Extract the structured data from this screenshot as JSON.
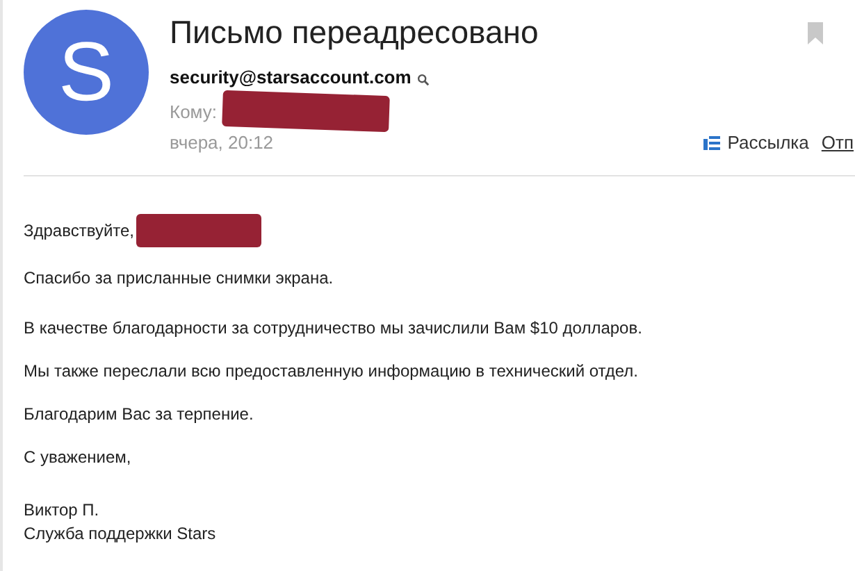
{
  "header": {
    "avatar_letter": "S",
    "subject": "Письмо переадресовано",
    "sender": "security@starsaccount.com",
    "recipient": {
      "label": "Кому:",
      "redacted": true
    },
    "date": "вчера, 20:12",
    "actions": [
      {
        "kind": "newsletter",
        "label": "Рассылка"
      },
      {
        "kind": "link",
        "label": "Отп"
      }
    ]
  },
  "body": {
    "greeting": {
      "text": "Здравствуйте,",
      "redacted": true
    },
    "paragraphs": [
      "Спасибо за присланные снимки экрана.",
      "В качестве благодарности за сотрудничество мы зачислили Вам $10 долларов.",
      "Мы также переслали всю предоставленную информацию в технический отдел.",
      "Благодарим Вас за терпение.",
      "С уважением,"
    ],
    "signature": [
      "Виктор П.",
      "Служба поддержки Stars"
    ]
  }
}
